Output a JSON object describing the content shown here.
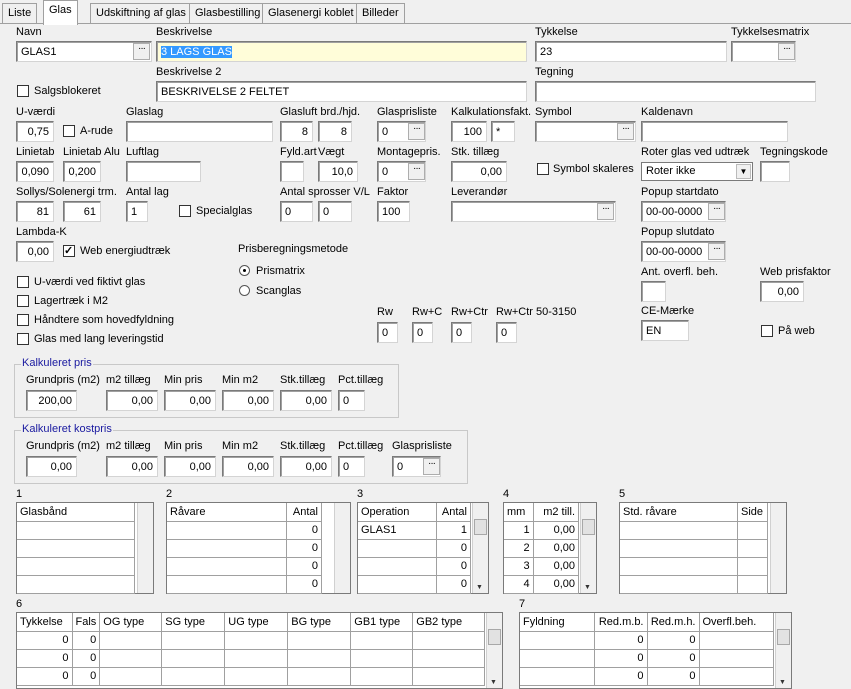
{
  "tabs": [
    "Liste",
    "Glas",
    "Udskiftning af glas",
    "Glasbestilling",
    "Glasenergi koblet",
    "Billeder"
  ],
  "fields": {
    "navn": {
      "label": "Navn",
      "value": "GLAS1"
    },
    "beskrivelse": {
      "label": "Beskrivelse",
      "value": "3 LAGS GLAS"
    },
    "tykkelse": {
      "label": "Tykkelse",
      "value": "23"
    },
    "tykkelsesmatrix": {
      "label": "Tykkelsesmatrix",
      "value": ""
    },
    "salgsblokeret": {
      "label": "Salgsblokeret"
    },
    "beskrivelse2": {
      "label": "Beskrivelse 2",
      "value": "BESKRIVELSE 2 FELTET"
    },
    "tegning": {
      "label": "Tegning",
      "value": ""
    },
    "uvaerdi": {
      "label": "U-værdi",
      "value": "0,75"
    },
    "arude": {
      "label": "A-rude"
    },
    "glaslag": {
      "label": "Glaslag",
      "value": ""
    },
    "glasluft": {
      "label": "Glasluft brd./hjd.",
      "v1": "8",
      "v2": "8"
    },
    "glasprisliste": {
      "label": "Glasprisliste",
      "value": "0"
    },
    "kalkfakt": {
      "label": "Kalkulationsfakt.",
      "v1": "100",
      "v2": "*"
    },
    "symbol": {
      "label": "Symbol",
      "value": ""
    },
    "kaldenavn": {
      "label": "Kaldenavn",
      "value": ""
    },
    "linietab": {
      "label": "Linietab",
      "value": "0,090"
    },
    "linietabalu": {
      "label": "Linietab Alu",
      "value": "0,200"
    },
    "luftlag": {
      "label": "Luftlag",
      "value": ""
    },
    "fyldart": {
      "label": "Fyld.art",
      "value": ""
    },
    "vaegt": {
      "label": "Vægt",
      "value": "10,0"
    },
    "montagepris": {
      "label": "Montagepris.",
      "value": "0"
    },
    "stktillaeg": {
      "label": "Stk. tillæg",
      "value": "0,00"
    },
    "symbolskaleres": {
      "label": "Symbol skaleres"
    },
    "roterglas": {
      "label": "Roter glas ved udtræk",
      "value": "Roter ikke"
    },
    "tegningskode": {
      "label": "Tegningskode",
      "value": ""
    },
    "sollys": {
      "label": "Sollys/Solenergi trm.",
      "v1": "81",
      "v2": "61"
    },
    "antallag": {
      "label": "Antal lag",
      "value": "1"
    },
    "specialglas": {
      "label": "Specialglas"
    },
    "antalsprosser": {
      "label": "Antal sprosser V/L",
      "v1": "0",
      "v2": "0"
    },
    "faktor": {
      "label": "Faktor",
      "value": "100"
    },
    "leverandor": {
      "label": "Leverandør",
      "value": ""
    },
    "popupstart": {
      "label": "Popup startdato",
      "value": "00-00-0000"
    },
    "lambdak": {
      "label": "Lambda-K",
      "value": "0,00"
    },
    "webenergi": {
      "label": "Web energiudtræk"
    },
    "popupslut": {
      "label": "Popup slutdato",
      "value": "00-00-0000"
    },
    "prisberegning": {
      "label": "Prisberegningsmetode",
      "opt1": "Prismatrix",
      "opt2": "Scanglas"
    },
    "fiktivt": {
      "label": "U-værdi ved fiktivt glas"
    },
    "lagertraek": {
      "label": "Lagertræk i M2"
    },
    "hovedfyldning": {
      "label": "Håndtere som hovedfyldning"
    },
    "langlevering": {
      "label": "Glas med lang leveringstid"
    },
    "antoverfl": {
      "label": "Ant. overfl. beh.",
      "value": ""
    },
    "webprisfaktor": {
      "label": "Web prisfaktor",
      "value": "0,00"
    },
    "rw": {
      "label": "Rw",
      "value": "0"
    },
    "rwc": {
      "label": "Rw+C",
      "value": "0"
    },
    "rwctr": {
      "label": "Rw+Ctr",
      "value": "0"
    },
    "rwctr50": {
      "label": "Rw+Ctr 50-3150",
      "value": "0"
    },
    "cemaerke": {
      "label": "CE-Mærke",
      "value": "EN"
    },
    "paaweb": {
      "label": "På web"
    }
  },
  "kalkpris": {
    "title": "Kalkuleret pris",
    "labels": [
      "Grundpris (m2)",
      "m2 tillæg",
      "Min pris",
      "Min m2",
      "Stk.tillæg",
      "Pct.tillæg"
    ],
    "values": [
      "200,00",
      "0,00",
      "0,00",
      "0,00",
      "0,00",
      "0"
    ]
  },
  "kalkkost": {
    "title": "Kalkuleret kostpris",
    "labels": [
      "Grundpris (m2)",
      "m2 tillæg",
      "Min pris",
      "Min m2",
      "Stk.tillæg",
      "Pct.tillæg",
      "Glasprisliste"
    ],
    "values": [
      "0,00",
      "0,00",
      "0,00",
      "0,00",
      "0,00",
      "0",
      "0"
    ]
  },
  "grids": {
    "g1": {
      "num": "1",
      "headers": [
        "Glasbånd"
      ]
    },
    "g2": {
      "num": "2",
      "headers": [
        "Råvare",
        "Antal"
      ],
      "rows": [
        [
          "",
          "0"
        ],
        [
          "",
          "0"
        ],
        [
          "",
          "0"
        ],
        [
          "",
          "0"
        ]
      ]
    },
    "g3": {
      "num": "3",
      "headers": [
        "Operation",
        "Antal"
      ],
      "rows": [
        [
          "GLAS1",
          "1"
        ],
        [
          "",
          "0"
        ],
        [
          "",
          "0"
        ],
        [
          "",
          "0"
        ]
      ]
    },
    "g4": {
      "num": "4",
      "headers": [
        "mm",
        "m2 till."
      ],
      "rows": [
        [
          "1",
          "0,00"
        ],
        [
          "2",
          "0,00"
        ],
        [
          "3",
          "0,00"
        ],
        [
          "4",
          "0,00"
        ]
      ]
    },
    "g5": {
      "num": "5",
      "headers": [
        "Std. råvare",
        "Side"
      ]
    },
    "g6": {
      "num": "6",
      "headers": [
        "Tykkelse",
        "Fals",
        "OG type",
        "SG type",
        "UG type",
        "BG type",
        "GB1 type",
        "GB2 type"
      ],
      "rows": [
        [
          "0",
          "0"
        ],
        [
          "0",
          "0"
        ],
        [
          "0",
          "0"
        ]
      ]
    },
    "g7": {
      "num": "7",
      "headers": [
        "Fyldning",
        "Red.m.b.",
        "Red.m.h.",
        "Overfl.beh."
      ],
      "rows": [
        [
          "",
          "0",
          "0"
        ],
        [
          "",
          "0",
          "0"
        ],
        [
          "",
          "0",
          "0"
        ]
      ]
    }
  }
}
